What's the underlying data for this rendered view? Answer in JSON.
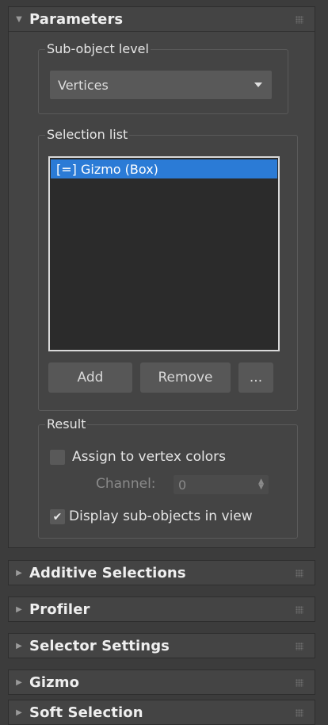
{
  "parameters": {
    "title": "Parameters",
    "subobject": {
      "legend": "Sub-object level",
      "value": "Vertices"
    },
    "selection": {
      "legend": "Selection list",
      "items": [
        "[=]  Gizmo (Box)"
      ],
      "add_label": "Add",
      "remove_label": "Remove",
      "more_label": "..."
    },
    "result": {
      "legend": "Result",
      "assign_label": "Assign to vertex colors",
      "assign_checked": false,
      "channel_label": "Channel:",
      "channel_value": "0",
      "display_label": "Display sub-objects in view",
      "display_checked": true
    }
  },
  "rollouts": [
    {
      "title": "Additive Selections"
    },
    {
      "title": "Profiler"
    },
    {
      "title": "Selector Settings"
    },
    {
      "title": "Gizmo"
    },
    {
      "title": "Soft Selection"
    }
  ],
  "icons": {
    "expanded": "triangle-down-icon",
    "collapsed": "triangle-right-icon",
    "grip": "grip-dots-icon",
    "check": "checkmark-icon"
  },
  "colors": {
    "panel_bg": "#444444",
    "selection_highlight": "#2b7bd6",
    "list_bg": "#2b2b2b"
  }
}
